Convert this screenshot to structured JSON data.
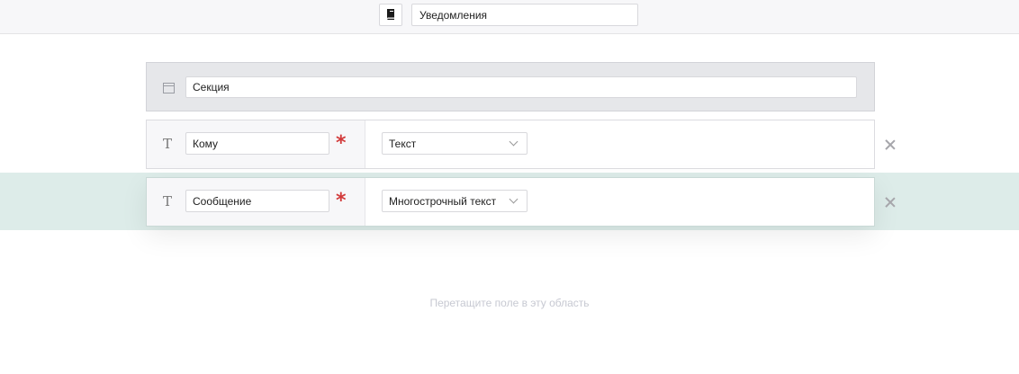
{
  "header": {
    "doc_icon": "book-icon",
    "title_value": "Уведомления"
  },
  "section": {
    "icon": "window-icon",
    "title_value": "Секция"
  },
  "fields": [
    {
      "type_icon_glyph": "T",
      "name_value": "Кому",
      "required_glyph": "*",
      "type_label": "Текст"
    },
    {
      "type_icon_glyph": "T",
      "name_value": "Сообщение",
      "required_glyph": "*",
      "type_label": "Многострочный текст"
    }
  ],
  "drop_hint": "Перетащите поле в эту область",
  "colors": {
    "required": "#d23a3a",
    "drop_highlight": "#ddece9",
    "section_bg": "#e6e7ea"
  }
}
